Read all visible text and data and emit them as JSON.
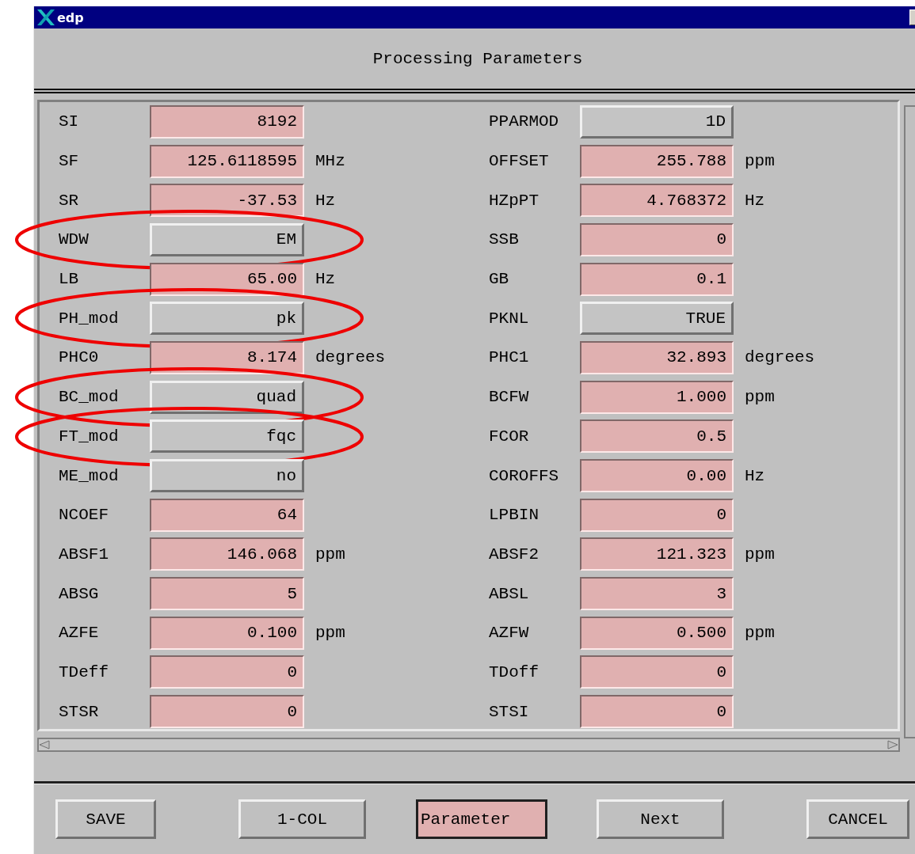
{
  "window": {
    "title": "edp"
  },
  "header": {
    "title": "Processing Parameters"
  },
  "rows": [
    {
      "left": {
        "name": "SI",
        "kind": "field",
        "value": "8192",
        "circled": false
      },
      "right": {
        "name": "PPARMOD",
        "kind": "menu",
        "value": "1D",
        "circled": false
      }
    },
    {
      "left": {
        "name": "SF",
        "kind": "field",
        "value": "125.6118595",
        "unit": "MHz",
        "circled": false
      },
      "right": {
        "name": "OFFSET",
        "kind": "field",
        "value": "255.788",
        "unit": "ppm",
        "circled": false
      }
    },
    {
      "left": {
        "name": "SR",
        "kind": "field",
        "value": "-37.53",
        "unit": "Hz",
        "circled": false
      },
      "right": {
        "name": "HZpPT",
        "kind": "field",
        "value": "4.768372",
        "unit": "Hz",
        "circled": false
      }
    },
    {
      "left": {
        "name": "WDW",
        "kind": "menu",
        "value": "EM",
        "circled": true
      },
      "right": {
        "name": "SSB",
        "kind": "field",
        "value": "0",
        "circled": false
      }
    },
    {
      "left": {
        "name": "LB",
        "kind": "field",
        "value": "65.00",
        "unit": "Hz",
        "circled": false
      },
      "right": {
        "name": "GB",
        "kind": "field",
        "value": "0.1",
        "circled": false
      }
    },
    {
      "left": {
        "name": "PH_mod",
        "kind": "menu",
        "value": "pk",
        "circled": true
      },
      "right": {
        "name": "PKNL",
        "kind": "menu",
        "value": "TRUE",
        "circled": false
      }
    },
    {
      "left": {
        "name": "PHC0",
        "kind": "field",
        "value": "8.174",
        "unit": "degrees",
        "circled": false
      },
      "right": {
        "name": "PHC1",
        "kind": "field",
        "value": "32.893",
        "unit": "degrees",
        "circled": false
      }
    },
    {
      "left": {
        "name": "BC_mod",
        "kind": "menu",
        "value": "quad",
        "circled": true
      },
      "right": {
        "name": "BCFW",
        "kind": "field",
        "value": "1.000",
        "unit": "ppm",
        "circled": false
      }
    },
    {
      "left": {
        "name": "FT_mod",
        "kind": "menu",
        "value": "fqc",
        "circled": true
      },
      "right": {
        "name": "FCOR",
        "kind": "field",
        "value": "0.5",
        "circled": false
      }
    },
    {
      "left": {
        "name": "ME_mod",
        "kind": "menu",
        "value": "no",
        "circled": false
      },
      "right": {
        "name": "COROFFS",
        "kind": "field",
        "value": "0.00",
        "unit": "Hz",
        "circled": false
      }
    },
    {
      "left": {
        "name": "NCOEF",
        "kind": "field",
        "value": "64",
        "circled": false
      },
      "right": {
        "name": "LPBIN",
        "kind": "field",
        "value": "0",
        "circled": false
      }
    },
    {
      "left": {
        "name": "ABSF1",
        "kind": "field",
        "value": "146.068",
        "unit": "ppm",
        "circled": false
      },
      "right": {
        "name": "ABSF2",
        "kind": "field",
        "value": "121.323",
        "unit": "ppm",
        "circled": false
      }
    },
    {
      "left": {
        "name": "ABSG",
        "kind": "field",
        "value": "5",
        "circled": false
      },
      "right": {
        "name": "ABSL",
        "kind": "field",
        "value": "3",
        "circled": false
      }
    },
    {
      "left": {
        "name": "AZFE",
        "kind": "field",
        "value": "0.100",
        "unit": "ppm",
        "circled": false
      },
      "right": {
        "name": "AZFW",
        "kind": "field",
        "value": "0.500",
        "unit": "ppm",
        "circled": false
      }
    },
    {
      "left": {
        "name": "TDeff",
        "kind": "field",
        "value": "0",
        "circled": false
      },
      "right": {
        "name": "TDoff",
        "kind": "field",
        "value": "0",
        "circled": false
      }
    },
    {
      "left": {
        "name": "STSR",
        "kind": "field",
        "value": "0",
        "circled": false
      },
      "right": {
        "name": "STSI",
        "kind": "field",
        "value": "0",
        "circled": false
      }
    }
  ],
  "buttons": [
    {
      "label": "SAVE",
      "selected": false
    },
    {
      "label": "1-COL",
      "selected": false
    },
    {
      "label": "Parameter",
      "selected": true
    },
    {
      "label": "Next",
      "selected": false
    },
    {
      "label": "CANCEL",
      "selected": false
    }
  ]
}
